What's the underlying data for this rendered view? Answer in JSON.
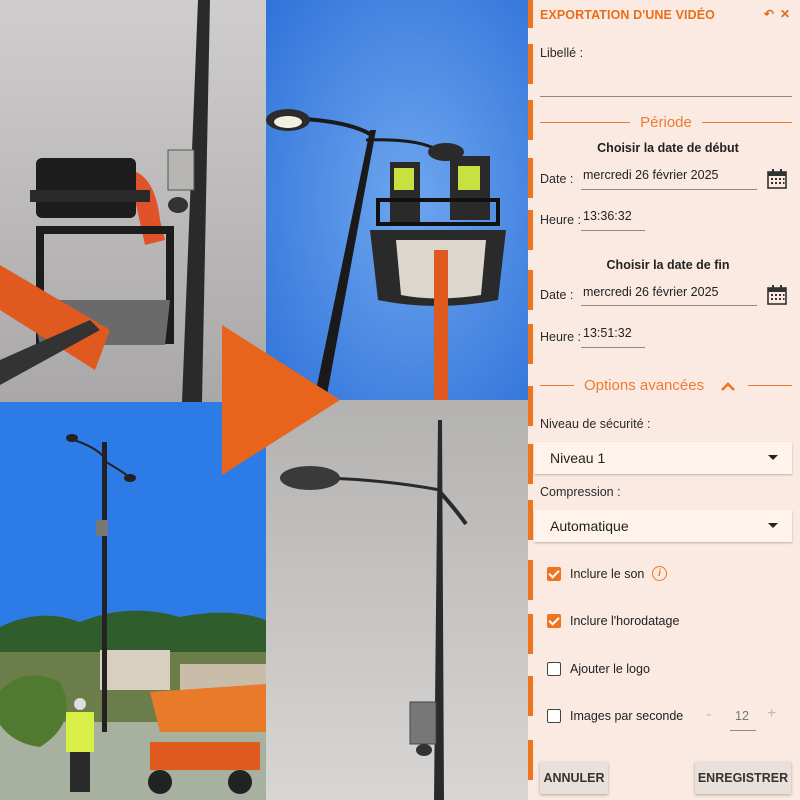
{
  "panel": {
    "title": "EXPORTATION D'UNE VIDÉO",
    "label_field": "Libellé :",
    "period_title": "Période",
    "start": {
      "heading": "Choisir la date de début",
      "date_label": "Date :",
      "date_value": "mercredi 26 février 2025",
      "time_label": "Heure :",
      "time_value": "13:36:32"
    },
    "end": {
      "heading": "Choisir la date de fin",
      "date_label": "Date :",
      "date_value": "mercredi 26 février 2025",
      "time_label": "Heure :",
      "time_value": "13:51:32"
    },
    "advanced_title": "Options avancées",
    "security_label": "Niveau de sécurité :",
    "security_value": "Niveau 1",
    "compression_label": "Compression :",
    "compression_value": "Automatique",
    "options": {
      "include_sound": {
        "label": "Inclure le son",
        "checked": true
      },
      "include_timestamp": {
        "label": "Inclure l'horodatage",
        "checked": true
      },
      "add_logo": {
        "label": "Ajouter le logo",
        "checked": false
      },
      "fps": {
        "label": "Images par seconde",
        "checked": false,
        "minus": "-",
        "value": "12",
        "plus": "+"
      }
    },
    "cancel": "ANNULER",
    "save": "ENREGISTRER"
  },
  "colors": {
    "accent": "#ee7420",
    "panel_bg": "#fbeae2",
    "sky_blue": "#2f7be0"
  },
  "icons": {
    "back": "undo-arrow-icon",
    "close": "close-icon",
    "calendar": "calendar-icon",
    "collapse": "chevron-up-icon",
    "info": "info-icon",
    "dropdown": "caret-down-icon"
  }
}
